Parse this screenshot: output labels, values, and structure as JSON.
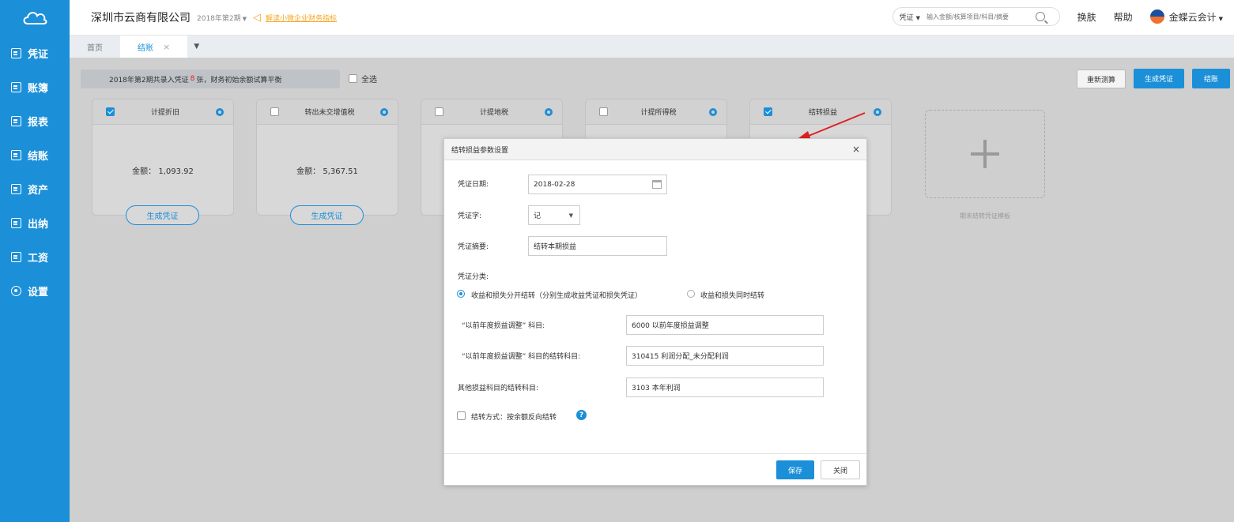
{
  "sidebar": {
    "items": [
      {
        "label": "凭证"
      },
      {
        "label": "账簿"
      },
      {
        "label": "报表"
      },
      {
        "label": "结账"
      },
      {
        "label": "资产"
      },
      {
        "label": "出纳"
      },
      {
        "label": "工资"
      },
      {
        "label": "设置"
      }
    ]
  },
  "header": {
    "company": "深圳市云商有限公司",
    "period": "2018年第2期",
    "notice_link": "解读小微企业财务指标",
    "search": {
      "type": "凭证",
      "placeholder": "输入金额/核算项目/科目/摘要"
    },
    "skin_label": "换肤",
    "help_label": "帮助",
    "user_name": "金蝶云会计"
  },
  "tabs": [
    {
      "label": "首页",
      "active": false
    },
    {
      "label": "结账",
      "active": true
    }
  ],
  "toolbar": {
    "banner_prefix": "2018年第2期共录入凭证",
    "banner_count": "8",
    "banner_suffix": "张，财务初始余额试算平衡",
    "select_all_label": "全选",
    "recalc_label": "重新测算",
    "generate_label": "生成凭证",
    "close_label": "结账"
  },
  "cards": [
    {
      "title": "计提折旧",
      "checked": true,
      "amount": "金额： 1,093.92",
      "button": "生成凭证"
    },
    {
      "title": "转出未交增值税",
      "checked": false,
      "amount": "金额： 5,367.51",
      "button": "生成凭证"
    },
    {
      "title": "计提地税",
      "checked": false
    },
    {
      "title": "计提所得税",
      "checked": false
    },
    {
      "title": "结转损益",
      "checked": true
    }
  ],
  "add_template_label": "期末结转凭证模板",
  "modal": {
    "title": "结转损益参数设置",
    "date_label": "凭证日期:",
    "date_value": "2018-02-28",
    "word_label": "凭证字:",
    "word_value": "记",
    "summary_label": "凭证摘要:",
    "summary_value": "结转本期损益",
    "category_label": "凭证分类:",
    "radio1_label": "收益和损失分开结转（分别生成收益凭证和损失凭证）",
    "radio2_label": "收益和损失同时结转",
    "prior_adj_label": "“以前年度损益调整” 科目:",
    "prior_adj_value": "6000 以前年度损益调整",
    "prior_transfer_label": "“以前年度损益调整” 科目的结转科目:",
    "prior_transfer_value": "310415 利润分配_未分配利润",
    "other_label": "其他损益科目的结转科目:",
    "other_value": "3103 本年利润",
    "method_label": "结转方式：按余额反向结转",
    "help_glyph": "?",
    "save_label": "保存",
    "close_label": "关闭"
  },
  "colors": {
    "brand": "#1b8fd8",
    "warning": "#f5a623",
    "arrow": "#e02020"
  }
}
